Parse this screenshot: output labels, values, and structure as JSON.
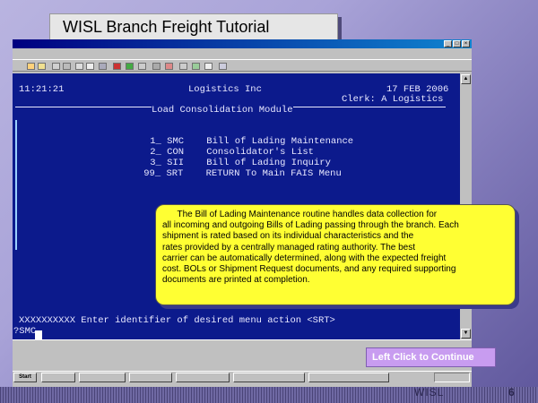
{
  "slide": {
    "title": "WISL Branch Freight Tutorial",
    "continue_label": "Left Click to Continue",
    "footer_brand": "WISL",
    "page_number": "6"
  },
  "terminal": {
    "time": "11:21:21",
    "company": "Logistics Inc",
    "date": "17 FEB 2006",
    "clerk": "Clerk: A Logistics",
    "module_title": "Load Consolidation Module",
    "menu_items": [
      {
        "number": "1_",
        "code": "SMC",
        "label": "Bill of Lading Maintenance"
      },
      {
        "number": "2_",
        "code": "CON",
        "label": "Consolidator's List"
      },
      {
        "number": "3_",
        "code": "SII",
        "label": "Bill of Lading Inquiry"
      },
      {
        "number": "99_",
        "code": "SRT",
        "label": "RETURN To Main FAIS Menu"
      }
    ],
    "prompt": "XXXXXXXXXX Enter identifier of desired menu action <SRT>",
    "input_value": "?SMC"
  },
  "callout": {
    "lines": [
      "      The Bill of Lading Maintenance routine handles data collection for",
      "all incoming and outgoing Bills of Lading passing through the branch. Each",
      "shipment is rated based on its individual characteristics and the",
      "rates provided by a centrally managed rating authority. The best",
      "carrier can be automatically determined, along with the expected freight",
      "cost. BOLs or Shipment Request documents, and any required supporting",
      "documents are printed at completion."
    ]
  },
  "taskbar": {
    "start_label": "Start"
  },
  "colors": {
    "terminal_bg": "#0c1a8c",
    "callout_bg": "#ffff33",
    "continue_bg": "#c89cf0",
    "titlebar": "#000080"
  }
}
